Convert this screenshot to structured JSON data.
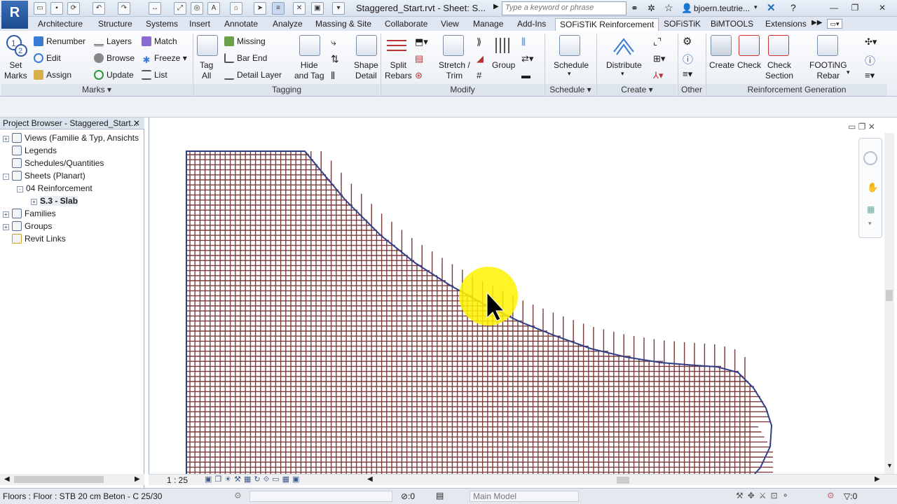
{
  "app": {
    "logo": "R",
    "title": "Staggered_Start.rvt - Sheet: S...",
    "search_placeholder": "Type a keyword or phrase",
    "user": "bjoern.teutrie..."
  },
  "tabs": [
    "Architecture",
    "Structure",
    "Systems",
    "Insert",
    "Annotate",
    "Analyze",
    "Massing & Site",
    "Collaborate",
    "View",
    "Manage",
    "Add-Ins",
    "SOFiSTiK Reinforcement",
    "SOFiSTiK",
    "BiMTOOLS",
    "Extensions"
  ],
  "active_tab": "SOFiSTiK Reinforcement",
  "ribbon": {
    "marks": {
      "title": "Marks",
      "set_marks": "Set\nMarks",
      "renumber": "Renumber",
      "edit": "Edit",
      "assign": "Assign",
      "layers": "Layers",
      "browse": "Browse",
      "update": "Update",
      "match": "Match",
      "freeze": "Freeze",
      "list": "List"
    },
    "tagging": {
      "title": "Tagging",
      "tag_all": "Tag\nAll",
      "missing": "Missing",
      "bar_end": "Bar End",
      "detail_layer": "Detail Layer",
      "hide_and_tag": "Hide\nand Tag"
    },
    "modify": {
      "title": "Modify",
      "shape_detail": "Shape\nDetail",
      "split_rebars": "Split\nRebars",
      "stretch_trim": "Stretch /\nTrim",
      "group": "Group"
    },
    "schedule": {
      "title": "Schedule",
      "schedule": "Schedule"
    },
    "create": {
      "title": "Create",
      "distribute": "Distribute"
    },
    "other": {
      "title": "Other"
    },
    "reinforcement_generation": {
      "title": "Reinforcement Generation",
      "create": "Create",
      "check": "Check",
      "check_section": "Check\nSection",
      "footing_rebar": "FOOTiNG\nRebar"
    }
  },
  "project_browser": {
    "title": "Project Browser - Staggered_Start...",
    "items": [
      {
        "label": "Views (Familie & Typ, Ansichts",
        "level": 0,
        "expander": "+",
        "icon": "views-icon"
      },
      {
        "label": "Legends",
        "level": 0,
        "expander": "",
        "icon": "legends-icon"
      },
      {
        "label": "Schedules/Quantities",
        "level": 0,
        "expander": "",
        "icon": "schedules-icon"
      },
      {
        "label": "Sheets (Planart)",
        "level": 0,
        "expander": "-",
        "icon": "sheets-icon"
      },
      {
        "label": "04 Reinforcement",
        "level": 1,
        "expander": "-",
        "icon": ""
      },
      {
        "label": "S.3 - Slab",
        "level": 2,
        "expander": "+",
        "icon": "",
        "bold": true
      },
      {
        "label": "Families",
        "level": 0,
        "expander": "+",
        "icon": "families-icon"
      },
      {
        "label": "Groups",
        "level": 0,
        "expander": "+",
        "icon": "groups-icon"
      },
      {
        "label": "Revit Links",
        "level": 0,
        "expander": "",
        "icon": "revit-links-icon"
      }
    ]
  },
  "view": {
    "scale": "1 : 25"
  },
  "status": {
    "selection": "Floors : Floor : STB 20 cm Beton - C 25/30",
    "count": ":0",
    "model": "Main Model",
    "filter_count": ":0"
  },
  "colors": {
    "rebar": "#7a3a3a",
    "slab_edge": "#2e3f8a",
    "cursor_highlight": "#fff200"
  }
}
